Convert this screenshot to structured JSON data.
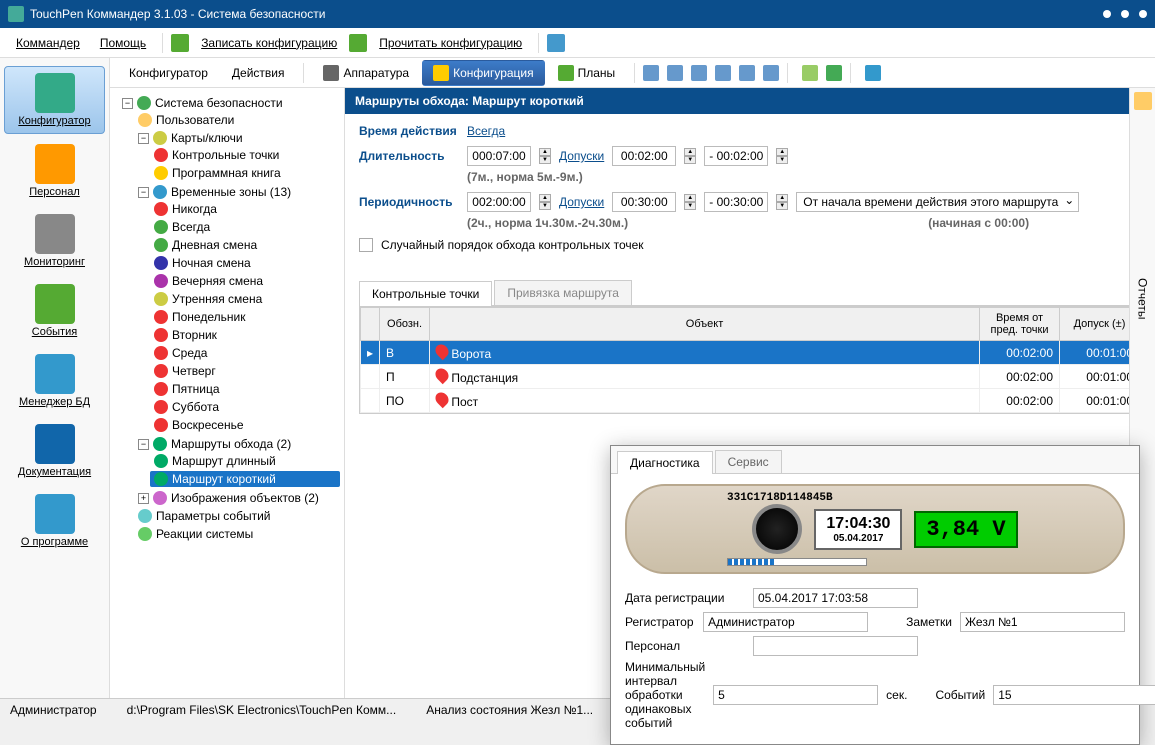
{
  "title": "TouchPen Коммандер 3.1.03 - Система безопасности",
  "menu": {
    "commander": "Коммандер",
    "help": "Помощь",
    "write": "Записать конфигурацию",
    "read": "Прочитать конфигурацию"
  },
  "sidebar": [
    {
      "label": "Конфигуратор",
      "active": true
    },
    {
      "label": "Персонал"
    },
    {
      "label": "Мониторинг"
    },
    {
      "label": "События"
    },
    {
      "label": "Менеджер БД"
    },
    {
      "label": "Документация"
    },
    {
      "label": "О программе"
    }
  ],
  "tabs": {
    "config": "Конфигуратор",
    "actions": "Действия",
    "hardware": "Аппаратура",
    "cfg": "Конфигурация",
    "plans": "Планы"
  },
  "tree": {
    "root": "Система безопасности",
    "users": "Пользователи",
    "cards": "Карты/ключи",
    "ctrl": "Контрольные точки",
    "book": "Программная книга",
    "tz": "Временные зоны (13)",
    "tz_items": [
      "Никогда",
      "Всегда",
      "Дневная смена",
      "Ночная смена",
      "Вечерняя смена",
      "Утренняя смена",
      "Понедельник",
      "Вторник",
      "Среда",
      "Четверг",
      "Пятница",
      "Суббота",
      "Воскресенье"
    ],
    "routes": "Маршруты обхода (2)",
    "route_long": "Маршрут длинный",
    "route_short": "Маршрут короткий",
    "objects": "Изображения объектов (2)",
    "params": "Параметры событий",
    "reactions": "Реакции системы"
  },
  "form": {
    "header": "Маршруты обхода: Маршрут короткий",
    "time_label": "Время действия",
    "time_value": "Всегда",
    "duration_label": "Длительность",
    "duration_value": "000:07:00",
    "tolerance_link": "Допуски",
    "dur_tol1": "00:02:00",
    "dur_tol2": "- 00:02:00",
    "dur_hint": "(7м., норма 5м.-9м.)",
    "period_label": "Периодичность",
    "period_value": "002:00:00",
    "per_tol1": "00:30:00",
    "per_tol2": "- 00:30:00",
    "per_hint": "(2ч., норма 1ч.30м.-2ч.30м.)",
    "select_value": "От начала времени действия этого маршрута",
    "start_hint": "(начиная с 00:00)",
    "random_label": "Случайный порядок обхода контрольных точек",
    "subtab1": "Контрольные точки",
    "subtab2": "Привязка маршрута",
    "cols": {
      "c1": "Обозн.",
      "c2": "Объект",
      "c3": "Время от пред. точки",
      "c4": "Допуск (±)"
    },
    "rows": [
      {
        "code": "В",
        "obj": "Ворота",
        "t": "00:02:00",
        "tol": "00:01:00",
        "sel": true
      },
      {
        "code": "П",
        "obj": "Подстанция",
        "t": "00:02:00",
        "tol": "00:01:00"
      },
      {
        "code": "ПО",
        "obj": "Пост",
        "t": "00:02:00",
        "tol": "00:01:00"
      }
    ]
  },
  "reports": "Отчеты",
  "device": {
    "tab1": "Диагностика",
    "tab2": "Сервис",
    "serial": "331C1718D114845B",
    "time": "17:04:30",
    "date": "05.04.2017",
    "voltage": "3,84 V",
    "reg_date_lbl": "Дата регистрации",
    "reg_date": "05.04.2017 17:03:58",
    "reg_lbl": "Регистратор",
    "reg_val": "Администратор",
    "notes_lbl": "Заметки",
    "notes_val": "Жезл №1",
    "pers_lbl": "Персонал",
    "pers_val": "",
    "min_lbl": "Минимальный интервал обработки одинаковых событий",
    "min_val": "5",
    "sec": "сек.",
    "ev_lbl": "Событий",
    "ev_val": "15"
  },
  "status": {
    "admin": "Администратор",
    "path": "d:\\Program Files\\SK Electronics\\TouchPen Комм...",
    "state": "Анализ состояния Жезл №1..."
  }
}
